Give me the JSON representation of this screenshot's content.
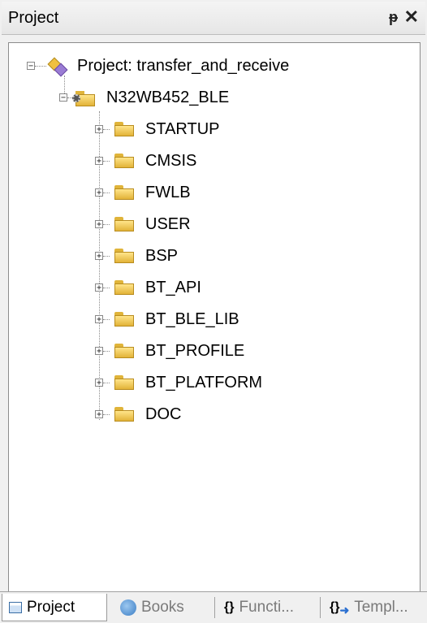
{
  "panel": {
    "title": "Project",
    "pin_icon": "pin-icon",
    "close_icon": "close-icon"
  },
  "tree": {
    "root": {
      "expander": "−",
      "label": "Project: transfer_and_receive"
    },
    "target": {
      "expander": "−",
      "label": "N32WB452_BLE"
    },
    "groups": [
      {
        "expander": "+",
        "label": "STARTUP"
      },
      {
        "expander": "+",
        "label": "CMSIS"
      },
      {
        "expander": "+",
        "label": "FWLB"
      },
      {
        "expander": "+",
        "label": "USER"
      },
      {
        "expander": "+",
        "label": "BSP"
      },
      {
        "expander": "+",
        "label": "BT_API"
      },
      {
        "expander": "+",
        "label": "BT_BLE_LIB"
      },
      {
        "expander": "+",
        "label": "BT_PROFILE"
      },
      {
        "expander": "+",
        "label": "BT_PLATFORM"
      },
      {
        "expander": "+",
        "label": "DOC"
      }
    ]
  },
  "bottom_tabs": [
    {
      "label": "Project",
      "icon": "project-icon"
    },
    {
      "label": "Books",
      "icon": "books-icon"
    },
    {
      "label": "Functi...",
      "icon": "braces-icon",
      "glyph": "{}"
    },
    {
      "label": "Templ...",
      "icon": "templates-icon",
      "glyph": "{}"
    }
  ]
}
